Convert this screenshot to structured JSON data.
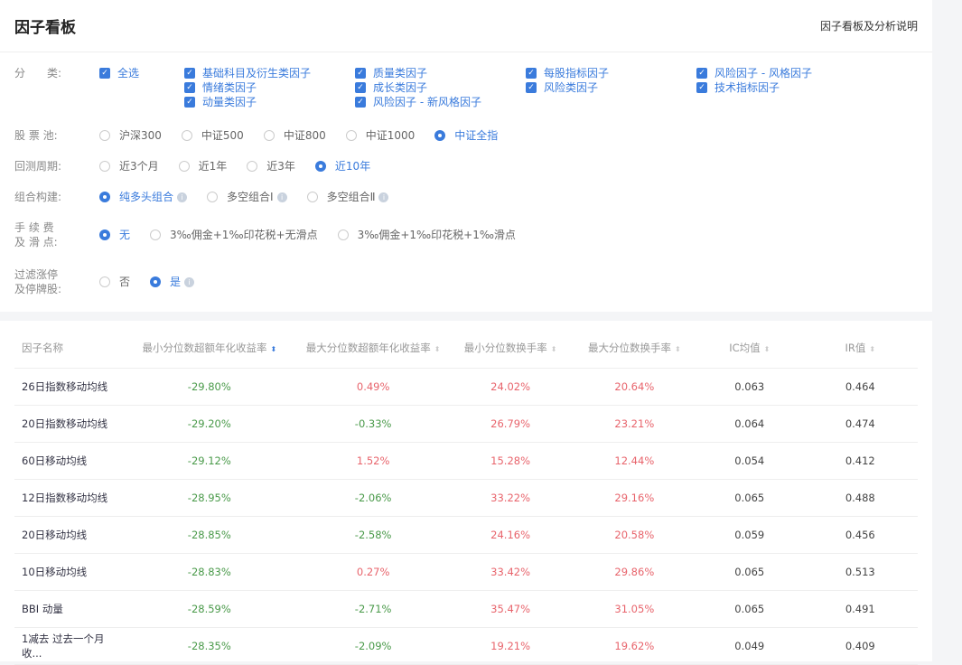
{
  "header": {
    "title": "因子看板",
    "help_link": "因子看板及分析说明"
  },
  "filters": {
    "category": {
      "label": "分　　类:",
      "all": "全选",
      "cols": [
        [
          "基础科目及衍生类因子",
          "情绪类因子",
          "动量类因子"
        ],
        [
          "质量类因子",
          "成长类因子",
          "风险因子 - 新风格因子"
        ],
        [
          "每股指标因子",
          "风险类因子"
        ],
        [
          "风险因子 - 风格因子",
          "技术指标因子"
        ]
      ]
    },
    "pool": {
      "label": "股 票 池:",
      "options": [
        "沪深300",
        "中证500",
        "中证800",
        "中证1000",
        "中证全指"
      ],
      "selected": 4
    },
    "period": {
      "label": "回测周期:",
      "options": [
        "近3个月",
        "近1年",
        "近3年",
        "近10年"
      ],
      "selected": 3
    },
    "portfolio": {
      "label": "组合构建:",
      "options": [
        "纯多头组合",
        "多空组合Ⅰ",
        "多空组合Ⅱ"
      ],
      "selected": 0
    },
    "fee": {
      "label1": "手 续 费",
      "label2": "及 滑 点:",
      "options": [
        "无",
        "3‰佣金+1‰印花税+无滑点",
        "3‰佣金+1‰印花税+1‰滑点"
      ],
      "selected": 0
    },
    "filter": {
      "label1": "过滤涨停",
      "label2": "及停牌股:",
      "options": [
        "否",
        "是"
      ],
      "selected": 1
    }
  },
  "table": {
    "columns": [
      "因子名称",
      "最小分位数超额年化收益率",
      "最大分位数超额年化收益率",
      "最小分位数换手率",
      "最大分位数换手率",
      "IC均值",
      "IR值"
    ],
    "rows": [
      [
        "26日指数移动均线",
        "-29.80%",
        "0.49%",
        "24.02%",
        "20.64%",
        "0.063",
        "0.464"
      ],
      [
        "20日指数移动均线",
        "-29.20%",
        "-0.33%",
        "26.79%",
        "23.21%",
        "0.064",
        "0.474"
      ],
      [
        "60日移动均线",
        "-29.12%",
        "1.52%",
        "15.28%",
        "12.44%",
        "0.054",
        "0.412"
      ],
      [
        "12日指数移动均线",
        "-28.95%",
        "-2.06%",
        "33.22%",
        "29.16%",
        "0.065",
        "0.488"
      ],
      [
        "20日移动均线",
        "-28.85%",
        "-2.58%",
        "24.16%",
        "20.58%",
        "0.059",
        "0.456"
      ],
      [
        "10日移动均线",
        "-28.83%",
        "0.27%",
        "33.42%",
        "29.86%",
        "0.065",
        "0.513"
      ],
      [
        "BBI 动量",
        "-28.59%",
        "-2.71%",
        "35.47%",
        "31.05%",
        "0.065",
        "0.491"
      ],
      [
        "1减去 过去一个月收...",
        "-28.35%",
        "-2.09%",
        "19.21%",
        "19.62%",
        "0.049",
        "0.409"
      ]
    ]
  },
  "colors": {
    "accent": "#3a7bdc",
    "negative": "#4a9a4a",
    "positive": "#e8646c"
  }
}
